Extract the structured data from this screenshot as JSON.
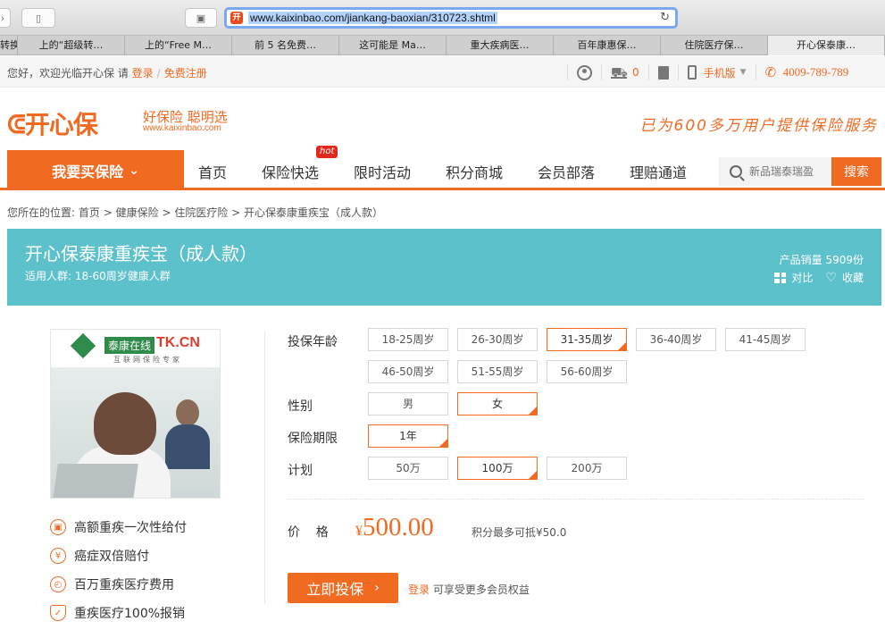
{
  "browser": {
    "url": "www.kaixinbao.com/jiankang-baoxian/310723.shtml",
    "tabs": [
      "转换",
      "上的“超级转…",
      "上的“Free M…",
      "前 5 名免费…",
      "这可能是 Ma…",
      "重大疾病医…",
      "百年康惠保…",
      "住院医疗保…",
      "开心保泰康…"
    ],
    "active_tab": 8
  },
  "topbar": {
    "welcome": "您好，欢迎光临开心保 请",
    "login": "登录",
    "separator": "/",
    "register": "免费注册",
    "cart_count": "0",
    "mobile": "手机版",
    "phone": "4009-789-789"
  },
  "header": {
    "logo": "开心保",
    "logo_sub": "好保险 聪明选",
    "logo_url": "www.kaixinbao.com",
    "slogan": "已为600多万用户提供保险服务"
  },
  "nav": {
    "buy_label": "我要买保险",
    "items": [
      "首页",
      "保险快选",
      "限时活动",
      "积分商城",
      "会员部落",
      "理赔通道"
    ],
    "hot": "hot",
    "search_placeholder": "新品瑞泰瑞盈",
    "search_btn": "搜索"
  },
  "breadcrumb": {
    "prefix": "您所在的位置:",
    "items": [
      "首页",
      "健康保险",
      "住院医疗险",
      "开心保泰康重疾宝（成人款）"
    ]
  },
  "product": {
    "title": "开心保泰康重疾宝（成人款）",
    "subtitle": "适用人群: 18-60周岁健康人群",
    "sales": "产品销量 5909份",
    "compare": "对比",
    "favorite": "收藏",
    "image_brand": "泰康在线",
    "image_brand_cn": "TK.CN",
    "image_tag": "互联网保险专家",
    "features": [
      "高额重疾一次性给付",
      "癌症双倍赔付",
      "百万重疾医疗费用",
      "重疾医疗100%报销"
    ],
    "feature_icons": [
      "gift-icon",
      "yen-icon",
      "medical-icon",
      "shield-icon"
    ]
  },
  "options": {
    "age_label": "投保年龄",
    "ages": [
      "18-25周岁",
      "26-30周岁",
      "31-35周岁",
      "36-40周岁",
      "41-45周岁",
      "46-50周岁",
      "51-55周岁",
      "56-60周岁"
    ],
    "age_selected": 2,
    "gender_label": "性别",
    "genders": [
      "男",
      "女"
    ],
    "gender_selected": 1,
    "term_label": "保险期限",
    "terms": [
      "1年"
    ],
    "term_selected": 0,
    "plan_label": "计划",
    "plans": [
      "50万",
      "100万",
      "200万"
    ],
    "plan_selected": 1
  },
  "price": {
    "label": "价    格",
    "symbol": "¥",
    "value": "500.00",
    "points_note": "积分最多可抵¥50.0"
  },
  "cta": {
    "buy": "立即投保",
    "login": "登录",
    "member_note": "可享受更多会员权益"
  },
  "colors": {
    "accent": "#f16a22",
    "band": "#5dc1cc"
  }
}
